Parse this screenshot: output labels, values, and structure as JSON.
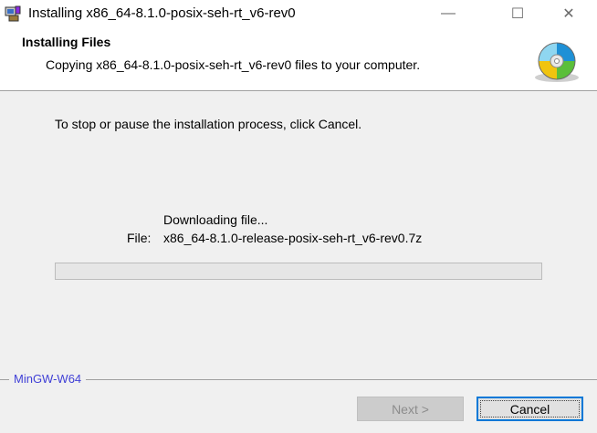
{
  "window": {
    "title": "Installing x86_64-8.1.0-posix-seh-rt_v6-rev0",
    "minimize_glyph": "—",
    "maximize_glyph": "☐",
    "close_glyph": "✕"
  },
  "header": {
    "title": "Installing Files",
    "subtitle": "Copying x86_64-8.1.0-posix-seh-rt_v6-rev0 files to your computer.",
    "icon": "cd-disc-icon"
  },
  "body": {
    "stop_text": "To stop or pause the installation process, click Cancel.",
    "status": "Downloading file...",
    "file_label": "File:",
    "file_name": "x86_64-8.1.0-release-posix-seh-rt_v6-rev0.7z",
    "progress_fraction": 0
  },
  "footer": {
    "brand": "MinGW-W64",
    "next_label": "Next >",
    "cancel_label": "Cancel"
  },
  "colors": {
    "accent": "#0078d7",
    "brand": "#3f3fd6"
  }
}
